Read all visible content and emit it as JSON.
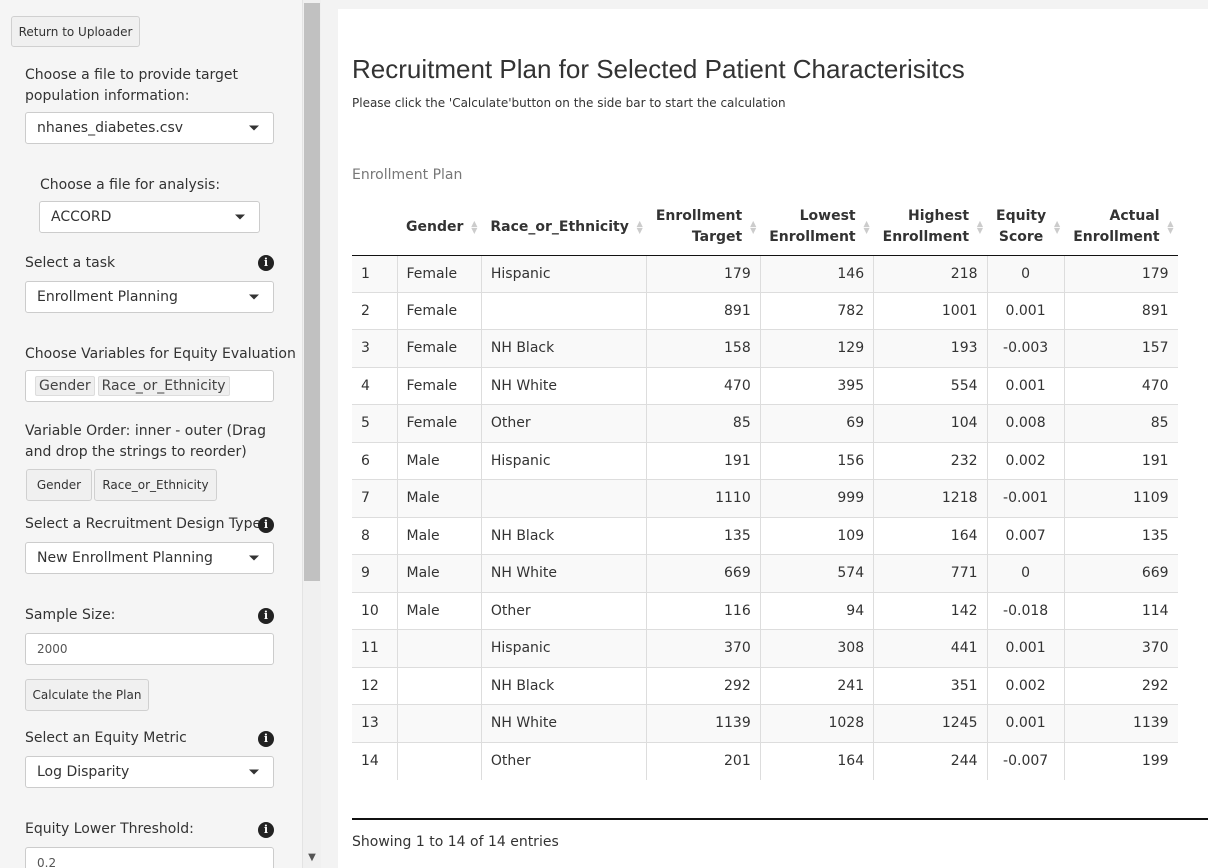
{
  "sidebar": {
    "return_button": "Return to Uploader",
    "target_file_label": "Choose a file to provide target population information:",
    "target_file_value": "nhanes_diabetes.csv",
    "analysis_file_label": "Choose a file for analysis:",
    "analysis_file_value": "ACCORD",
    "task_label": "Select a task",
    "task_value": "Enrollment Planning",
    "equity_vars_label": "Choose Variables for Equity Evaluation",
    "equity_vars": [
      "Gender",
      "Race_or_Ethnicity"
    ],
    "var_order_label": "Variable Order: inner - outer (Drag and drop the strings to reorder)",
    "var_order_chips": [
      "Gender",
      "Race_or_Ethnicity"
    ],
    "design_label": "Select a Recruitment Design Type",
    "design_value": "New Enrollment Planning",
    "sample_size_label": "Sample Size:",
    "sample_size_value": "2000",
    "calc_button": "Calculate the Plan",
    "metric_label": "Select an Equity Metric",
    "metric_value": "Log Disparity",
    "lower_threshold_label": "Equity Lower Threshold:",
    "lower_threshold_value": "0.2"
  },
  "main": {
    "title": "Recruitment Plan for Selected Patient Characterisitcs",
    "subtitle": "Please click the 'Calculate'button on the side bar to start the calculation",
    "caption": "Enrollment Plan",
    "table": {
      "headers": [
        "",
        "Gender",
        "Race_or_Ethnicity",
        "Enrollment Target",
        "Lowest Enrollment",
        "Highest Enrollment",
        "Equity Score",
        "Actual Enrollment"
      ],
      "rows": [
        [
          "1",
          "Female",
          "Hispanic",
          "179",
          "146",
          "218",
          "0",
          "179"
        ],
        [
          "2",
          "Female",
          "",
          "891",
          "782",
          "1001",
          "0.001",
          "891"
        ],
        [
          "3",
          "Female",
          "NH Black",
          "158",
          "129",
          "193",
          "-0.003",
          "157"
        ],
        [
          "4",
          "Female",
          "NH White",
          "470",
          "395",
          "554",
          "0.001",
          "470"
        ],
        [
          "5",
          "Female",
          "Other",
          "85",
          "69",
          "104",
          "0.008",
          "85"
        ],
        [
          "6",
          "Male",
          "Hispanic",
          "191",
          "156",
          "232",
          "0.002",
          "191"
        ],
        [
          "7",
          "Male",
          "",
          "1110",
          "999",
          "1218",
          "-0.001",
          "1109"
        ],
        [
          "8",
          "Male",
          "NH Black",
          "135",
          "109",
          "164",
          "0.007",
          "135"
        ],
        [
          "9",
          "Male",
          "NH White",
          "669",
          "574",
          "771",
          "0",
          "669"
        ],
        [
          "10",
          "Male",
          "Other",
          "116",
          "94",
          "142",
          "-0.018",
          "114"
        ],
        [
          "11",
          "",
          "Hispanic",
          "370",
          "308",
          "441",
          "0.001",
          "370"
        ],
        [
          "12",
          "",
          "NH Black",
          "292",
          "241",
          "351",
          "0.002",
          "292"
        ],
        [
          "13",
          "",
          "NH White",
          "1139",
          "1028",
          "1245",
          "0.001",
          "1139"
        ],
        [
          "14",
          "",
          "Other",
          "201",
          "164",
          "244",
          "-0.007",
          "199"
        ]
      ]
    },
    "info": "Showing 1 to 14 of 14 entries"
  },
  "icons": {
    "info": "info-icon",
    "dropdown": "chevron-down-icon",
    "sort": "sort-icon"
  },
  "colors": {
    "sidebar_bg": "#f5f5f5",
    "scrollbar_thumb": "#c1c1c1",
    "info_icon": "#222222"
  }
}
